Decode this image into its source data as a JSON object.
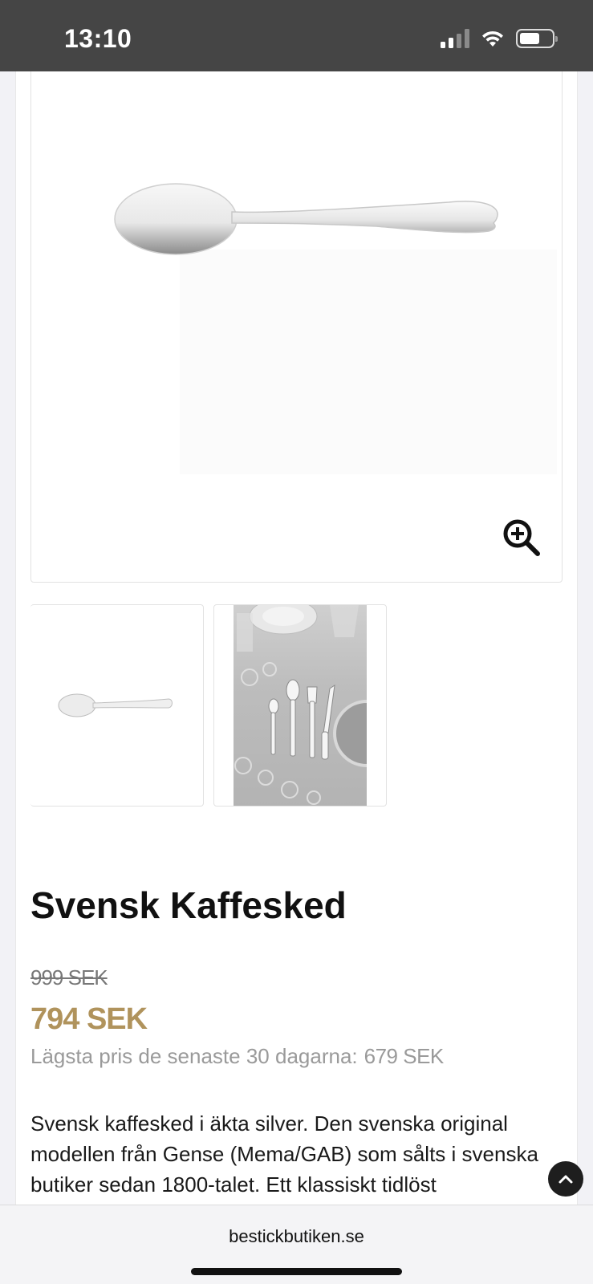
{
  "status_bar": {
    "time": "13:10"
  },
  "product": {
    "title": "Svensk Kaffesked",
    "old_price": "999 SEK",
    "price": "794 SEK",
    "lowest_label": "Lägsta pris de senaste 30 dagarna:",
    "lowest_value": "679 SEK",
    "description": "Svensk kaffesked i äkta silver. Den svenska original modellen från Gense (Mema/GAB) som sålts i svenska butiker sedan 1800-talet. Ett klassiskt tidlöst"
  },
  "browser": {
    "url": "bestickbutiken.se"
  },
  "colors": {
    "price": "#b0935c",
    "status_bar": "#454545"
  },
  "icons": [
    "signal-icon",
    "wifi-icon",
    "battery-icon",
    "zoom-in-icon",
    "chevron-up-icon"
  ]
}
